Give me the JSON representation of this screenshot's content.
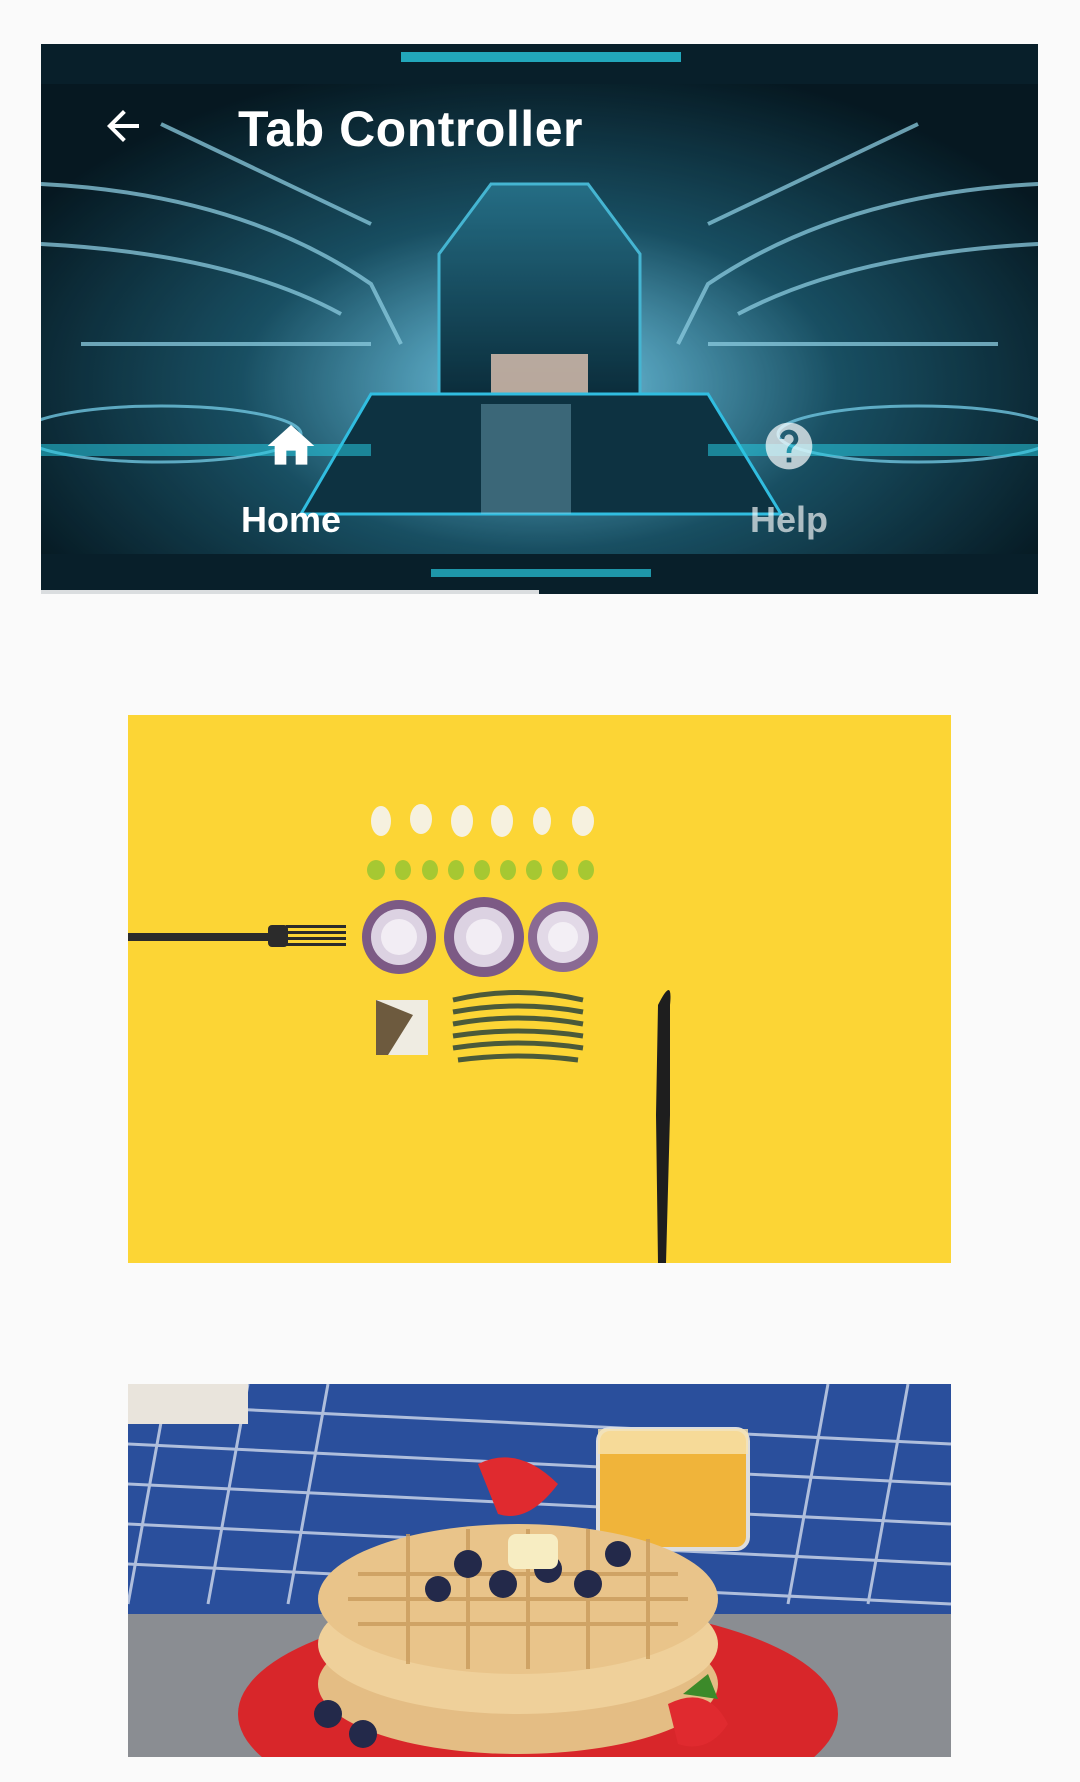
{
  "appbar": {
    "title": "Tab Controller",
    "back_icon": "arrow-back-icon"
  },
  "tabs": [
    {
      "label": "Home",
      "icon": "home-icon",
      "selected": true
    },
    {
      "label": "Help",
      "icon": "help-circle-icon",
      "selected": false
    }
  ],
  "images": [
    {
      "name": "ingredients-on-yellow-image"
    },
    {
      "name": "waffles-breakfast-image"
    }
  ],
  "colors": {
    "background": "#fafafa",
    "tab_selected": "#ffffff",
    "tab_unselected": "#ffffffa6",
    "appbar_tint": "#0b2a36"
  }
}
